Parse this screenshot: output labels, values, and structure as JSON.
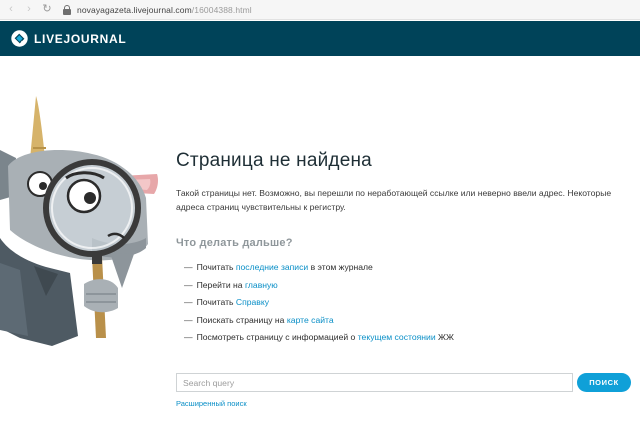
{
  "browser": {
    "url_host": "novayagazeta.livejournal.com",
    "url_path": "/16004388.html",
    "back_glyph": "‹",
    "forward_glyph": "›",
    "reload_glyph": "↻"
  },
  "header": {
    "logo_text": "LIVEJOURNAL",
    "background_color": "#004359"
  },
  "error": {
    "title": "Страница не найдена",
    "description": "Такой страницы нет. Возможно, вы перешли по неработающей ссылке или неверно ввели адрес. Некоторые адреса страниц чувствительны к регистру."
  },
  "next_steps": {
    "title": "Что делать дальше?",
    "dash": "—",
    "items": [
      {
        "prefix": "Почитать ",
        "link": "последние записи",
        "suffix": " в этом журнале"
      },
      {
        "prefix": "Перейти на ",
        "link": "главную",
        "suffix": ""
      },
      {
        "prefix": "Почитать ",
        "link": "Справку",
        "suffix": ""
      },
      {
        "prefix": "Поискать страницу на ",
        "link": "карте сайта",
        "suffix": ""
      },
      {
        "prefix": "Посмотреть страницу с информацией о ",
        "link": "текущем состоянии",
        "suffix": " ЖЖ"
      }
    ]
  },
  "search": {
    "placeholder": "Search query",
    "value": "",
    "button_label": "ПОИСК",
    "advanced_link": "Расширенный поиск"
  },
  "colors": {
    "link": "#0a8fc7",
    "button": "#0fa0d8"
  }
}
